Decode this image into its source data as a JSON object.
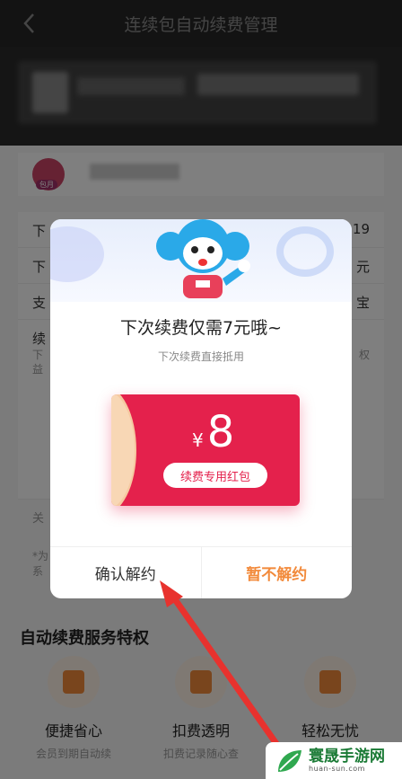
{
  "header": {
    "title": "连续包自动续费管理"
  },
  "background": {
    "badge": "包月",
    "rows": [
      {
        "label": "下",
        "value": "19"
      },
      {
        "label": "下",
        "value": "元"
      },
      {
        "label": "支",
        "value": "宝"
      },
      {
        "label": "续",
        "value": ""
      }
    ],
    "row_extra": {
      "line1": "下",
      "line2": "益",
      "right": "权"
    },
    "close_label": "关",
    "note_prefix": "*为",
    "note_line2": "系"
  },
  "privileges": {
    "title": "自动续费服务特权",
    "items": [
      {
        "name": "便捷省心",
        "desc": "会员到期自动续",
        "icon": "heart-shield-icon"
      },
      {
        "name": "扣费透明",
        "desc": "扣费记录随心查",
        "icon": "yuan-shield-icon"
      },
      {
        "name": "轻松无忧",
        "desc": "",
        "icon": "check-shield-icon"
      }
    ]
  },
  "modal": {
    "title": "下次续费仅需7元哦~",
    "subtitle": "下次续费直接抵用",
    "coupon": {
      "currency": "¥",
      "amount": "8",
      "tag": "续费专用红包"
    },
    "confirm_label": "确认解约",
    "keep_label": "暂不解约"
  },
  "watermark": {
    "name": "寰晟手游网",
    "url": "huan-sun.com"
  },
  "colors": {
    "accent": "#f28a3b",
    "envelope": "#e4214c",
    "arrow": "#e8322e"
  }
}
